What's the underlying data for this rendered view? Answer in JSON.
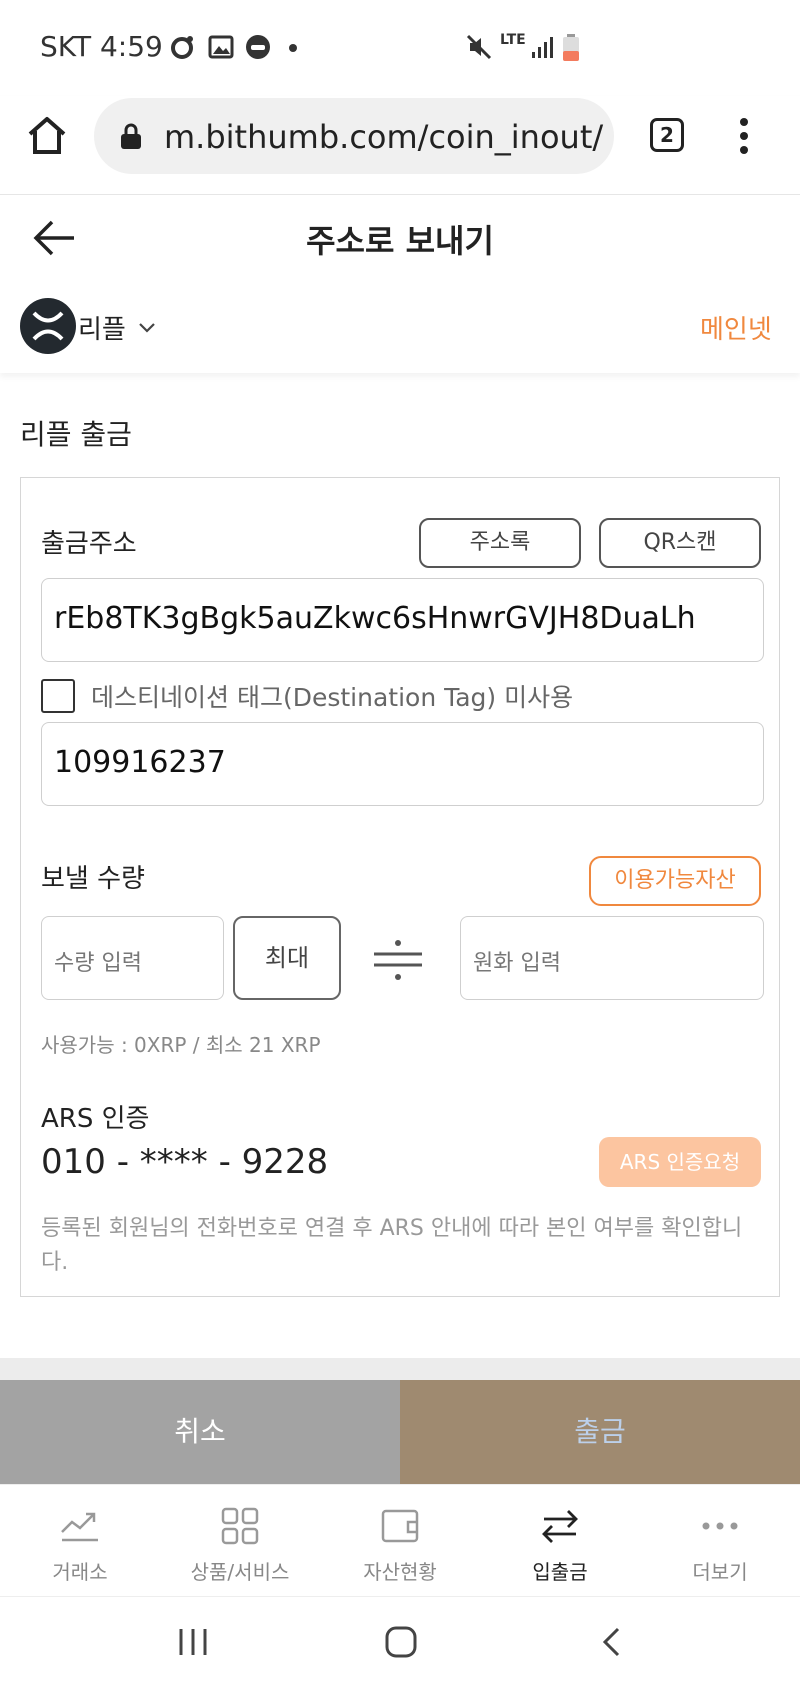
{
  "status_bar": {
    "carrier_time": "SKT 4:59",
    "network": "LTE"
  },
  "browser": {
    "url": "m.bithumb.com/coin_inout/v",
    "tab_count": "2"
  },
  "header": {
    "title": "주소로 보내기",
    "coin_name": "리플",
    "network_label": "메인넷"
  },
  "section_title": "리플 출금",
  "withdraw_address": {
    "label": "출금주소",
    "address_book_button": "주소록",
    "qr_scan_button": "QR스캔",
    "address_value": "rEb8TK3gBgk5auZkwc6sHnwrGVJH8DuaLh",
    "dest_tag_checkbox_label": "데스티네이션 태그(Destination Tag) 미사용",
    "dest_tag_value": "109916237"
  },
  "amount": {
    "label": "보낼 수량",
    "available_assets_button": "이용가능자산",
    "amount_placeholder": "수량 입력",
    "max_button": "최대",
    "krw_placeholder": "원화 입력",
    "hint": "사용가능 : 0XRP / 최소 21 XRP"
  },
  "ars": {
    "title": "ARS 인증",
    "phone": "010 - **** - 9228",
    "request_button": "ARS 인증요청",
    "description": "등록된 회원님의 전화번호로 연결 후 ARS 안내에 따라 본인 여부를 확인합니다."
  },
  "actions": {
    "cancel": "취소",
    "withdraw": "출금"
  },
  "tabbar": {
    "items": [
      {
        "label": "거래소",
        "icon": "chart-trend-icon"
      },
      {
        "label": "상품/서비스",
        "icon": "grid-icon"
      },
      {
        "label": "자산현황",
        "icon": "wallet-icon"
      },
      {
        "label": "입출금",
        "icon": "transfer-arrows-icon",
        "active": true
      },
      {
        "label": "더보기",
        "icon": "more-dots-icon"
      }
    ]
  },
  "colors": {
    "accent_orange": "#f0883e",
    "withdraw_button": "#9f8a70",
    "cancel_button": "#a3a3a3",
    "ars_button": "#fcc5a0"
  }
}
